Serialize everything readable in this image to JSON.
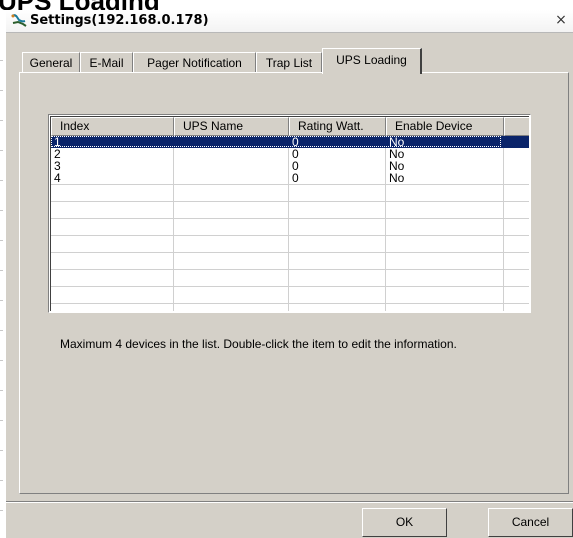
{
  "clipped_heading": "UPS Loading",
  "window": {
    "title": "Settings(192.168.0.178)",
    "close_glyph": "×",
    "icon": "scorpion-app-icon"
  },
  "tabs": [
    {
      "label": "General",
      "active": false
    },
    {
      "label": "E-Mail",
      "active": false
    },
    {
      "label": "Pager Notification",
      "active": false
    },
    {
      "label": "Trap List",
      "active": false
    },
    {
      "label": "UPS Loading",
      "active": true
    }
  ],
  "table": {
    "columns": [
      "Index",
      "UPS Name",
      "Rating Watt.",
      "Enable Device"
    ],
    "rows": [
      {
        "index": "1",
        "ups_name": "",
        "rating_watt": "0",
        "enable_device": "No",
        "selected": true
      },
      {
        "index": "2",
        "ups_name": "",
        "rating_watt": "0",
        "enable_device": "No",
        "selected": false
      },
      {
        "index": "3",
        "ups_name": "",
        "rating_watt": "0",
        "enable_device": "No",
        "selected": false
      },
      {
        "index": "4",
        "ups_name": "",
        "rating_watt": "0",
        "enable_device": "No",
        "selected": false
      }
    ]
  },
  "info_text": "Maximum 4 devices in the list. Double-click the item to edit the information.",
  "buttons": {
    "ok": "OK",
    "cancel": "Cancel"
  },
  "colors": {
    "dialog_face": "#d4d0c8",
    "selection": "#0a246a"
  }
}
